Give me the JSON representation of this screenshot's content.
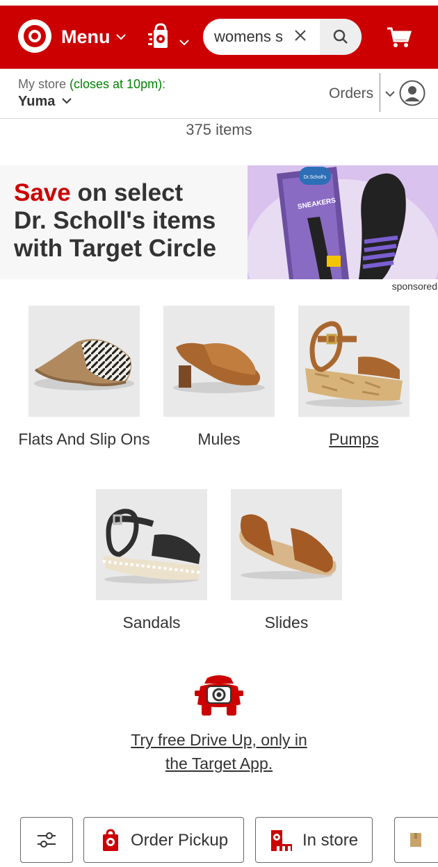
{
  "header": {
    "menu_label": "Menu",
    "search": {
      "value": "womens s"
    },
    "icons": [
      "target-bullseye-logo",
      "store-bag-icon",
      "close-icon",
      "search-icon",
      "cart-icon"
    ]
  },
  "store": {
    "prefix": "My store ",
    "hours": "(closes at 10pm)",
    "suffix": ":",
    "name": "Yuma",
    "orders_label": "Orders"
  },
  "results": {
    "count_text": "375 items"
  },
  "ad": {
    "save": "Save",
    "line1_rest": " on select",
    "line2": "Dr. Scholl's items",
    "line3": "with Target Circle",
    "image_brand": "Dr.Scholl's",
    "image_product": "SNEAKERS",
    "sponsored_label": "sponsored"
  },
  "categories": [
    {
      "label": "Flats And Slip Ons"
    },
    {
      "label": "Mules"
    },
    {
      "label": "Pumps"
    },
    {
      "label": "Sandals"
    },
    {
      "label": "Slides"
    }
  ],
  "driveup": {
    "line1": "Try free Drive Up, only in",
    "line2": "the Target App."
  },
  "chips": {
    "order_pickup": "Order Pickup",
    "in_store": "In store"
  },
  "colors": {
    "brand_red": "#cc0000",
    "green": "#008300",
    "text": "#333333"
  }
}
